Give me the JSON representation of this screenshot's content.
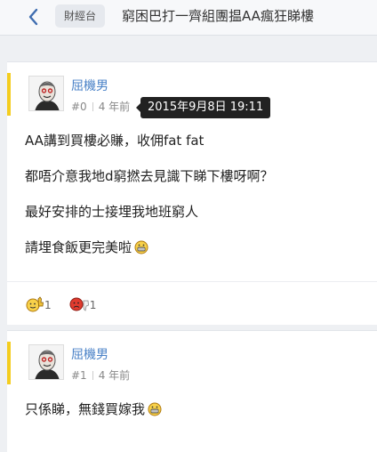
{
  "header": {
    "back_icon": "chevron-left-icon",
    "forum_tag": "財經台",
    "title": "窮困巴打一齊組團揾AA瘋狂睇樓"
  },
  "posts": [
    {
      "author": "屈機男",
      "floor": "#0",
      "time": "4 年前",
      "tooltip": "2015年9月8日 19:11",
      "lines": [
        "AA講到買樓必賺，收佣fat fat",
        "都唔介意我地d窮撚去見識下睇下樓呀啊？",
        "最好安排的士接埋我地班窮人",
        "請埋食飯更完美啦"
      ],
      "reactions": {
        "like_count": "1",
        "dislike_count": "1",
        "like_icon": "thumbs-up-emoji-icon",
        "dislike_icon": "thumbs-down-emoji-icon"
      }
    },
    {
      "author": "屈機男",
      "floor": "#1",
      "time": "4 年前",
      "lines": [
        "只係睇，無錢買嫁我"
      ]
    }
  ],
  "colors": {
    "accent": "#f4cd1f",
    "username": "#4a82c7",
    "tooltip_bg": "#222222"
  }
}
